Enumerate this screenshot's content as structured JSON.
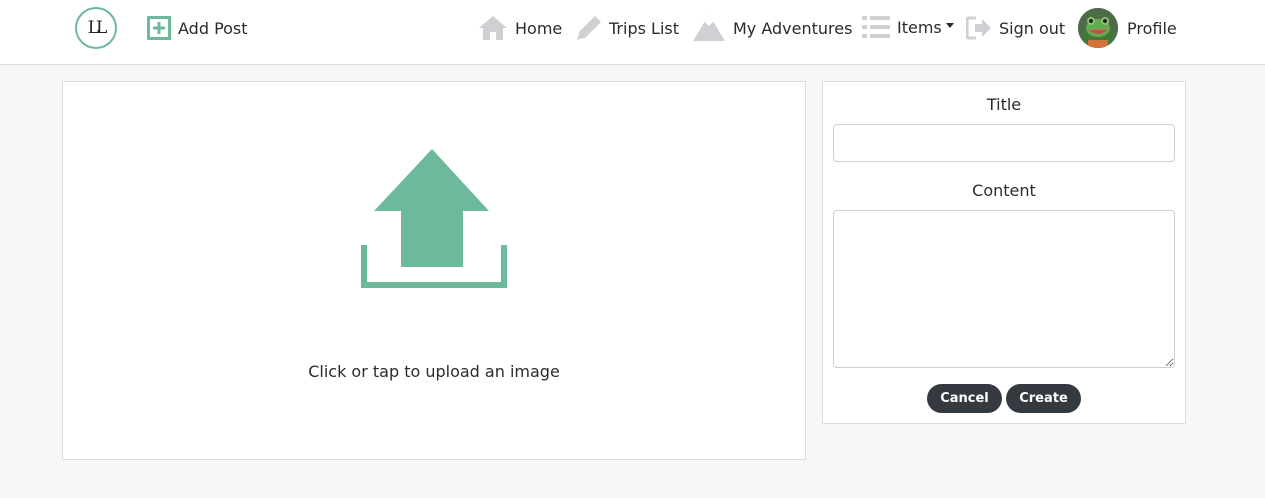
{
  "nav": {
    "logo_text": "LL",
    "add_post": "Add Post",
    "home": "Home",
    "trips_list": "Trips List",
    "my_adventures": "My Adventures",
    "items": "Items",
    "sign_out": "Sign out",
    "profile": "Profile"
  },
  "upload": {
    "prompt": "Click or tap to upload an image"
  },
  "form": {
    "title_label": "Title",
    "title_value": "",
    "content_label": "Content",
    "content_value": "",
    "cancel_label": "Cancel",
    "create_label": "Create"
  },
  "colors": {
    "accent": "#6dba9a",
    "nav_icon": "#cfcfd4",
    "button_bg": "#343a40"
  },
  "icons": {
    "add_post": "plus-square-icon",
    "home": "home-icon",
    "trips_list": "pencil-icon",
    "my_adventures": "mountain-icon",
    "items": "list-icon",
    "sign_out": "sign-out-icon",
    "upload": "upload-icon"
  }
}
